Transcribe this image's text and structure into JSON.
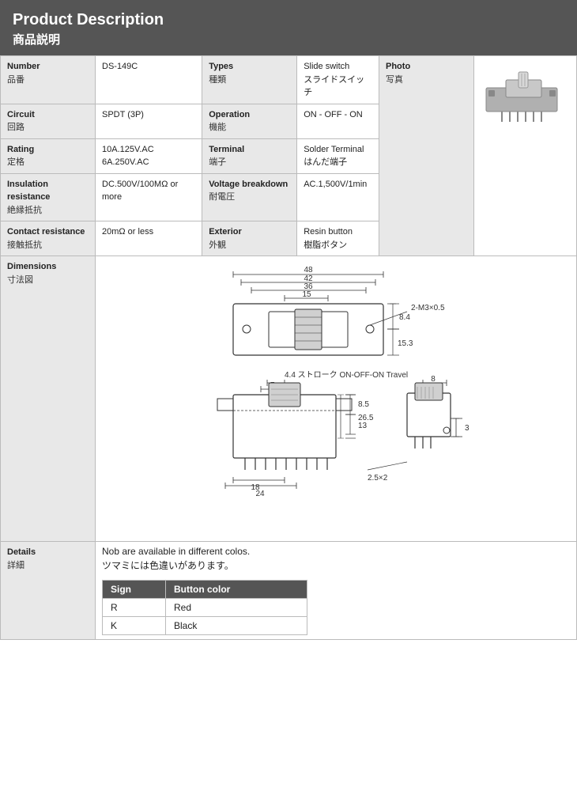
{
  "header": {
    "title_en": "Product Description",
    "title_ja": "商品説明"
  },
  "specs": {
    "number_label_en": "Number",
    "number_label_ja": "品番",
    "number_value": "DS-149C",
    "types_label_en": "Types",
    "types_label_ja": "種類",
    "types_value_en": "Slide switch",
    "types_value_ja": "スライドスイッチ",
    "photo_label_en": "Photo",
    "photo_label_ja": "写真",
    "circuit_label_en": "Circuit",
    "circuit_label_ja": "回路",
    "circuit_value": "SPDT (3P)",
    "operation_label_en": "Operation",
    "operation_label_ja": "機能",
    "operation_value": "ON - OFF - ON",
    "rating_label_en": "Rating",
    "rating_label_ja": "定格",
    "rating_value_line1": "10A.125V.AC",
    "rating_value_line2": "6A.250V.AC",
    "terminal_label_en": "Terminal",
    "terminal_label_ja": "端子",
    "terminal_value_en": "Solder Terminal",
    "terminal_value_ja": "はんだ端子",
    "insulation_label_en": "Insulation resistance",
    "insulation_label_ja": "絶縁抵抗",
    "insulation_value": "DC.500V/100MΩ or more",
    "voltage_label_en": "Voltage breakdown",
    "voltage_label_ja": "耐電圧",
    "voltage_value": "AC.1,500V/1min",
    "contact_label_en": "Contact resistance",
    "contact_label_ja": "接触抵抗",
    "contact_value": "20mΩ or less",
    "exterior_label_en": "Exterior",
    "exterior_label_ja": "外観",
    "exterior_value_en": "Resin button",
    "exterior_value_ja": "樹脂ボタン"
  },
  "dimensions": {
    "section_label_en": "Dimensions",
    "section_label_ja": "寸法図"
  },
  "details": {
    "section_label_en": "Details",
    "section_label_ja": "詳細",
    "note_en": "Nob are available in different colos.",
    "note_ja": "ツマミには色違いがあります。",
    "table_col1": "Sign",
    "table_col2": "Button color",
    "row1_sign": "R",
    "row1_color": "Red",
    "row2_sign": "K",
    "row2_color": "Black"
  }
}
